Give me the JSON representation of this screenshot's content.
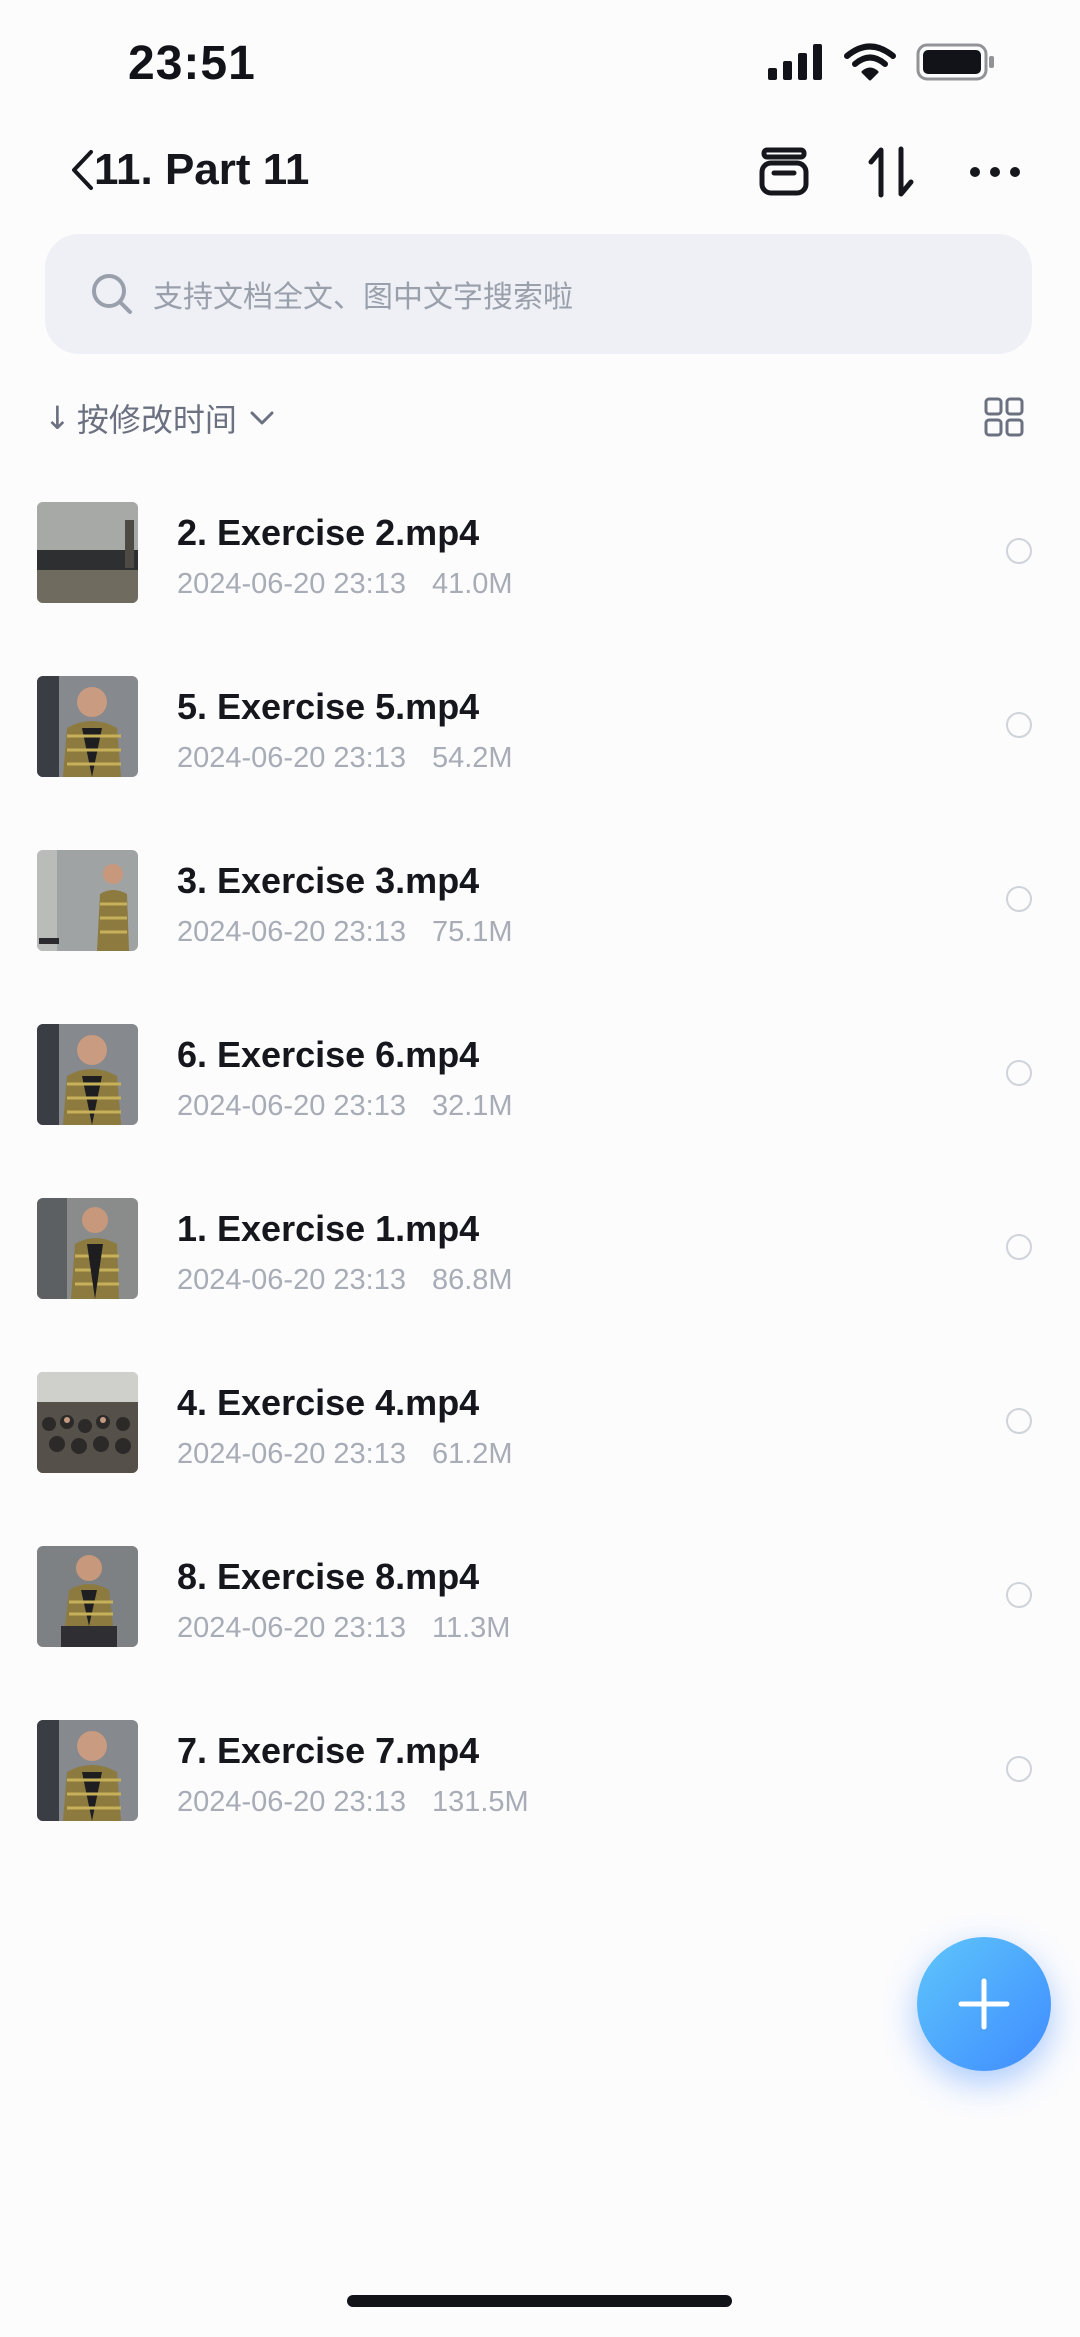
{
  "status_bar": {
    "time": "23:51",
    "icons": [
      "signal-icon",
      "wifi-icon",
      "battery-icon"
    ]
  },
  "nav": {
    "title": "11. Part 11",
    "actions": [
      "archive-icon",
      "sort-arrows-icon",
      "more-icon"
    ]
  },
  "search": {
    "placeholder": "支持文档全文、图中文字搜索啦"
  },
  "sort": {
    "arrow": "↓",
    "label": "按修改时间"
  },
  "files": [
    {
      "name": "2. Exercise 2.mp4",
      "date": "2024-06-20 23:13",
      "size": "41.0M",
      "thumb": "room-empty"
    },
    {
      "name": "5. Exercise 5.mp4",
      "date": "2024-06-20 23:13",
      "size": "54.2M",
      "thumb": "person-close"
    },
    {
      "name": "3. Exercise 3.mp4",
      "date": "2024-06-20 23:13",
      "size": "75.1M",
      "thumb": "person-far"
    },
    {
      "name": "6. Exercise 6.mp4",
      "date": "2024-06-20 23:13",
      "size": "32.1M",
      "thumb": "person-close"
    },
    {
      "name": "1. Exercise 1.mp4",
      "date": "2024-06-20 23:13",
      "size": "86.8M",
      "thumb": "person-mid"
    },
    {
      "name": "4. Exercise 4.mp4",
      "date": "2024-06-20 23:13",
      "size": "61.2M",
      "thumb": "audience"
    },
    {
      "name": "8. Exercise 8.mp4",
      "date": "2024-06-20 23:13",
      "size": "11.3M",
      "thumb": "person-seated"
    },
    {
      "name": "7. Exercise 7.mp4",
      "date": "2024-06-20 23:13",
      "size": "131.5M",
      "thumb": "person-close"
    }
  ],
  "fab": {
    "icon": "plus-icon",
    "color": "#4a9dff"
  }
}
